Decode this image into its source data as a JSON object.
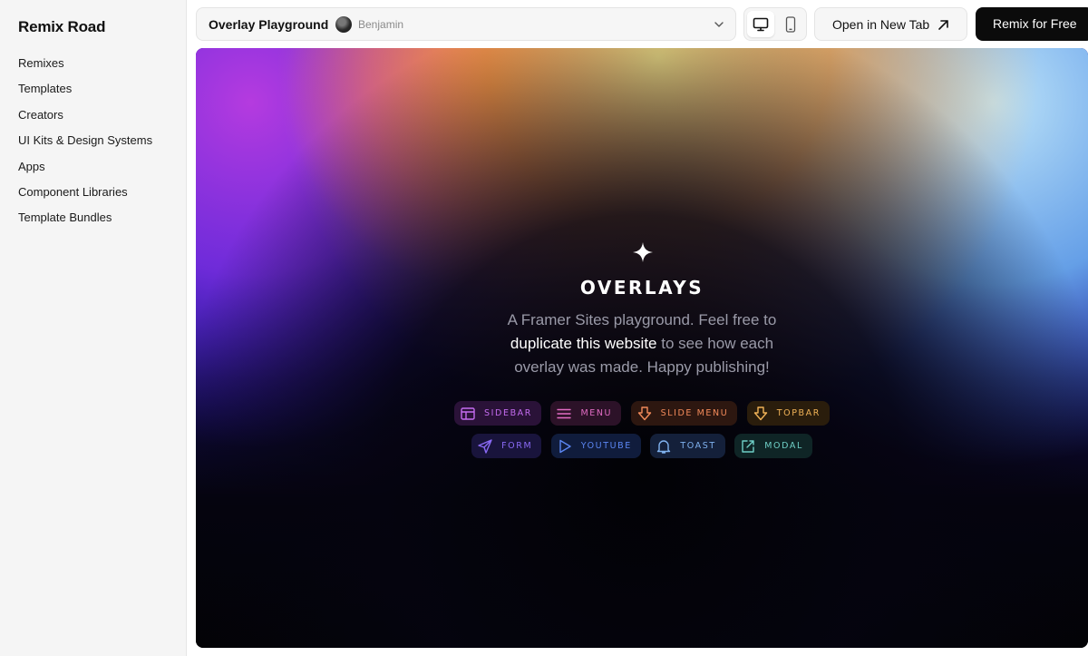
{
  "sidebar": {
    "brand": "Remix Road",
    "items": [
      {
        "label": "Remixes"
      },
      {
        "label": "Templates"
      },
      {
        "label": "Creators"
      },
      {
        "label": "UI Kits & Design Systems"
      },
      {
        "label": "Apps"
      },
      {
        "label": "Component Libraries"
      },
      {
        "label": "Template Bundles"
      }
    ]
  },
  "topbar": {
    "project_title": "Overlay Playground",
    "author": "Benjamin",
    "open_new_tab": "Open in New Tab",
    "remix": "Remix for Free",
    "active_device": "desktop"
  },
  "preview": {
    "title": "OVERLAYS",
    "text_1": "A Framer Sites playground. Feel free to",
    "text_highlight": "duplicate this website",
    "text_2": "to see how each overlay was made. Happy publishing!",
    "chips": [
      {
        "label": "SIDEBAR",
        "icon": "sidebar-layout-icon",
        "color": "#c46cf0",
        "bg": "#2a1238"
      },
      {
        "label": "MENU",
        "icon": "menu-icon",
        "color": "#e26cc4",
        "bg": "#2c1228"
      },
      {
        "label": "SLIDE MENU",
        "icon": "arrow-down-icon",
        "color": "#f28a5a",
        "bg": "#2d1710"
      },
      {
        "label": "TOPBAR",
        "icon": "arrow-down-icon",
        "color": "#f0b257",
        "bg": "#2a1d0c"
      },
      {
        "label": "FORM",
        "icon": "send-icon",
        "color": "#8a6af5",
        "bg": "#19143c"
      },
      {
        "label": "YOUTUBE",
        "icon": "play-icon",
        "color": "#5b86f2",
        "bg": "#101c3c"
      },
      {
        "label": "TOAST",
        "icon": "bell-icon",
        "color": "#7fb1ee",
        "bg": "#14203a"
      },
      {
        "label": "MODAL",
        "icon": "external-link-icon",
        "color": "#6fcfc6",
        "bg": "#0f2526"
      }
    ]
  }
}
